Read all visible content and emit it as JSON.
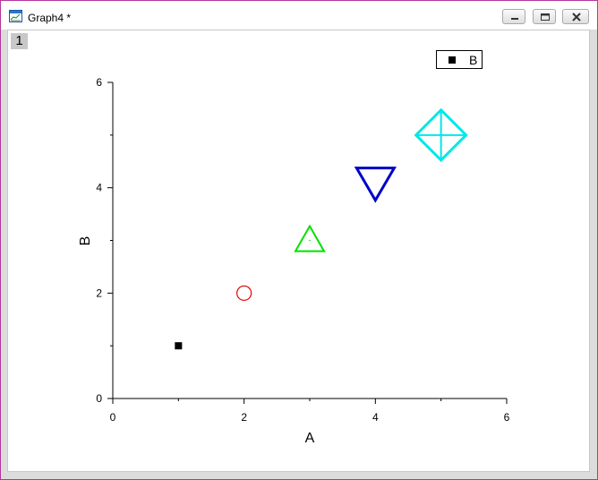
{
  "window": {
    "title": "Graph4 *",
    "layer_label": "1",
    "frame_color": "#b6359c",
    "icons": [
      "graph-window-icon",
      "minimize-icon",
      "restore-icon",
      "close-icon"
    ]
  },
  "legend": {
    "label": "B",
    "symbol": "filled-square",
    "position": "top-right"
  },
  "chart_data": {
    "type": "scatter",
    "xlabel": "A",
    "ylabel": "B",
    "xlim": [
      0,
      6
    ],
    "ylim": [
      0,
      6
    ],
    "x_ticks": [
      0,
      2,
      4,
      6
    ],
    "y_ticks": [
      0,
      2,
      4,
      6
    ],
    "grid": false,
    "series": [
      {
        "name": "B",
        "x": [
          1,
          2,
          3,
          4,
          5
        ],
        "y": [
          1,
          2,
          3,
          4,
          5
        ],
        "markers": [
          "filled-square",
          "circle",
          "triangle-up",
          "triangle-down",
          "diamond-cross"
        ],
        "colors": [
          "#000000",
          "#e00000",
          "#00e000",
          "#0000c8",
          "#00e8e8"
        ]
      }
    ]
  }
}
